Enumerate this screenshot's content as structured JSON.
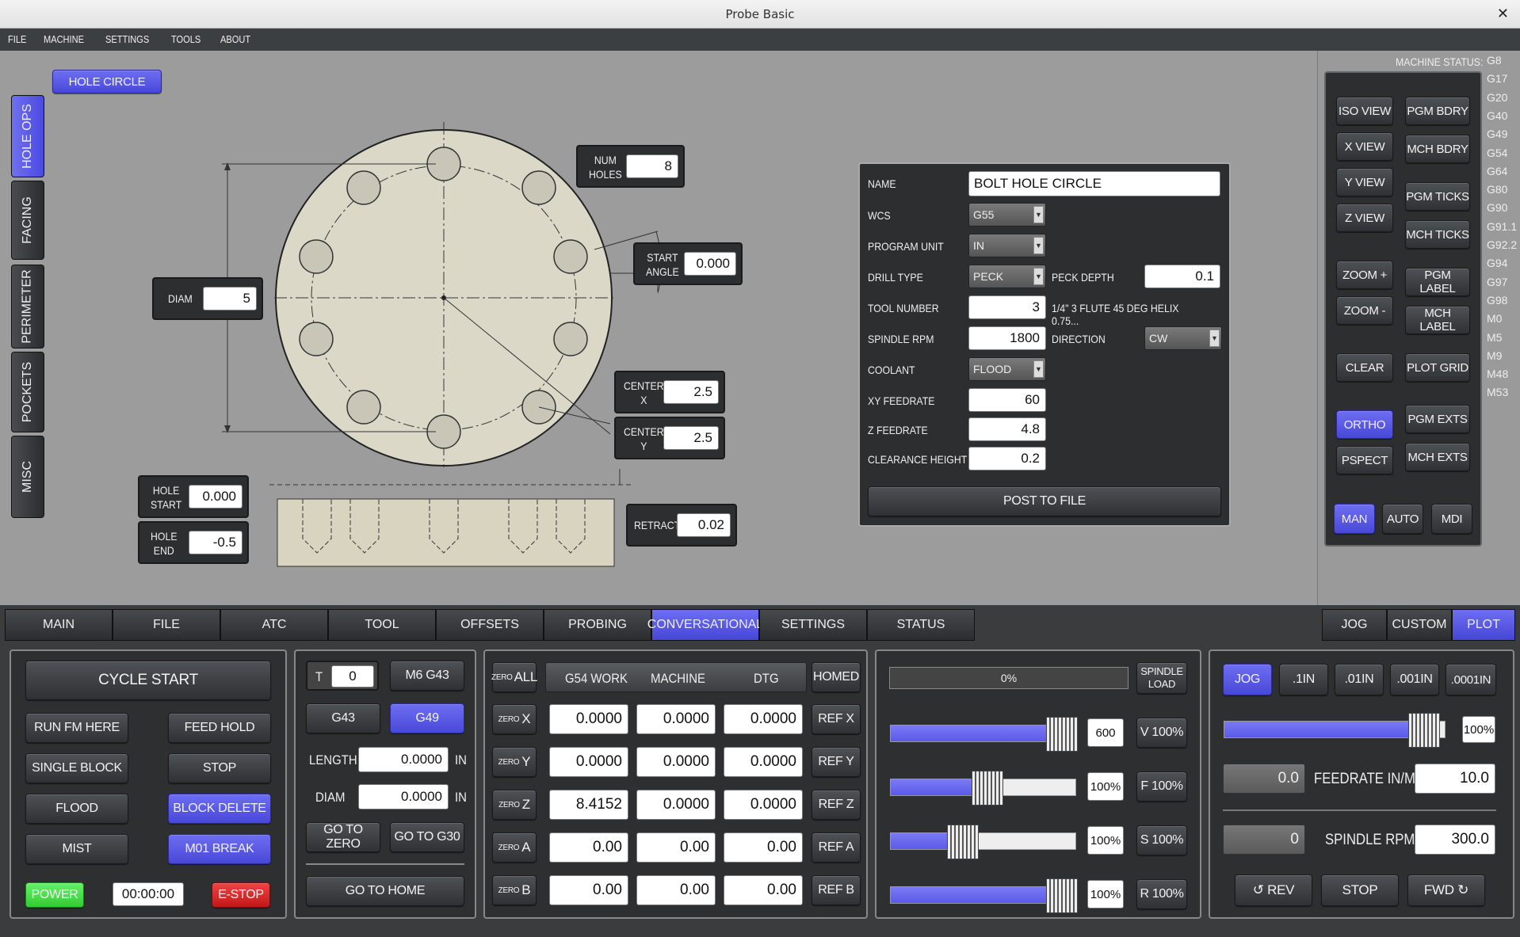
{
  "window": {
    "title": "Probe Basic",
    "close": "✕"
  },
  "menu": [
    "FILE",
    "MACHINE",
    "SETTINGS",
    "TOOLS",
    "ABOUT"
  ],
  "hole_circle_label": "HOLE CIRCLE",
  "side_tabs": [
    "HOLE OPS",
    "FACING",
    "PERIMETER",
    "POCKETS",
    "MISC"
  ],
  "diagram": {
    "num_holes_label": "NUM\nHOLES",
    "num_holes": "8",
    "start_angle_label": "START\nANGLE",
    "start_angle": "0.000",
    "diam_label": "DIAM",
    "diam": "5",
    "center_x_label": "CENTER\nX",
    "center_x": "2.5",
    "center_y_label": "CENTER\nY",
    "center_y": "2.5",
    "hole_start_label": "HOLE\nSTART",
    "hole_start": "0.000",
    "hole_end_label": "HOLE\nEND",
    "hole_end": "-0.5",
    "retract_label": "RETRACT",
    "retract": "0.02"
  },
  "form": {
    "name_label": "NAME",
    "name": "BOLT HOLE CIRCLE",
    "wcs_label": "WCS",
    "wcs": "G55",
    "unit_label": "PROGRAM UNIT",
    "unit": "IN",
    "drill_label": "DRILL TYPE",
    "drill": "PECK",
    "peck_label": "PECK DEPTH",
    "peck": "0.1",
    "tool_label": "TOOL NUMBER",
    "tool": "3",
    "tool_desc": "1/4\" 3 FLUTE 45 DEG HELIX 0.75...",
    "rpm_label": "SPINDLE RPM",
    "rpm": "1800",
    "dir_label": "DIRECTION",
    "dir": "CW",
    "coolant_label": "COOLANT",
    "coolant": "FLOOD",
    "xy_label": "XY FEEDRATE",
    "xy": "60",
    "z_label": "Z FEEDRATE",
    "z": "4.8",
    "clear_label": "CLEARANCE HEIGHT",
    "clear": "0.2",
    "post": "POST TO FILE"
  },
  "machine_status": {
    "title": "MACHINE STATUS:",
    "codes": [
      "G8",
      "G17",
      "G20",
      "G40",
      "G49",
      "G54",
      "G64",
      "G80",
      "G90",
      "G91.1",
      "G92.2",
      "G94",
      "G97",
      "G98",
      "M0",
      "M5",
      "M9",
      "M48",
      "M53"
    ]
  },
  "view_buttons": {
    "iso": "ISO VIEW",
    "x": "X VIEW",
    "y": "Y VIEW",
    "z": "Z VIEW",
    "zin": "ZOOM +",
    "zout": "ZOOM -",
    "clear": "CLEAR",
    "ortho": "ORTHO",
    "pspect": "PSPECT",
    "pgm_bdry": "PGM BDRY",
    "mch_bdry": "MCH BDRY",
    "pgm_ticks": "PGM TICKS",
    "mch_ticks": "MCH TICKS",
    "pgm_label": "PGM LABEL",
    "mch_label": "MCH LABEL",
    "plot_grid": "PLOT GRID",
    "pgm_exts": "PGM EXTS",
    "mch_exts": "MCH EXTS",
    "man": "MAN",
    "auto": "AUTO",
    "mdi": "MDI"
  },
  "bottom_tabs": [
    "MAIN",
    "FILE",
    "ATC",
    "TOOL",
    "OFFSETS",
    "PROBING",
    "CONVERSATIONAL",
    "SETTINGS",
    "STATUS"
  ],
  "right_tabs": [
    "JOG",
    "CUSTOM",
    "PLOT"
  ],
  "controls": {
    "cycle_start": "CYCLE START",
    "run_fm_here": "RUN FM HERE",
    "feed_hold": "FEED HOLD",
    "single_block": "SINGLE BLOCK",
    "stop": "STOP",
    "flood": "FLOOD",
    "block_delete": "BLOCK DELETE",
    "mist": "MIST",
    "m01": "M01 BREAK",
    "power": "POWER",
    "timer": "00:00:00",
    "estop": "E-STOP"
  },
  "tool_panel": {
    "t_label": "T",
    "t": "0",
    "m6g43": "M6 G43",
    "g43": "G43",
    "g49": "G49",
    "length_label": "LENGTH",
    "length": "0.0000",
    "in": "IN",
    "diam_label": "DIAM",
    "diam": "0.0000",
    "goto_zero": "GO TO ZERO",
    "goto_g30": "GO TO G30",
    "goto_home": "GO TO HOME"
  },
  "dro": {
    "zero_all_small": "ZERO",
    "zero_all": "ALL",
    "headers": [
      "G54 WORK",
      "MACHINE",
      "DTG"
    ],
    "homed": "HOMED",
    "rows": [
      {
        "axis": "X",
        "work": "0.0000",
        "mach": "0.0000",
        "dtg": "0.0000",
        "ref": "REF X"
      },
      {
        "axis": "Y",
        "work": "0.0000",
        "mach": "0.0000",
        "dtg": "0.0000",
        "ref": "REF Y"
      },
      {
        "axis": "Z",
        "work": "8.4152",
        "mach": "0.0000",
        "dtg": "0.0000",
        "ref": "REF Z"
      },
      {
        "axis": "A",
        "work": "0.00",
        "mach": "0.00",
        "dtg": "0.00",
        "ref": "REF A"
      },
      {
        "axis": "B",
        "work": "0.00",
        "mach": "0.00",
        "dtg": "0.00",
        "ref": "REF B"
      }
    ]
  },
  "overrides": {
    "load": "0%",
    "spindle_load": "SPINDLE\nLOAD",
    "rapid_val": "600",
    "v": "V 100%",
    "feed_val": "100%",
    "f": "F 100%",
    "spin_val": "100%",
    "s": "S 100%",
    "r_val": "100%",
    "r": "R 100%",
    "levels": {
      "rapid": 0.85,
      "feed": 0.45,
      "spindle": 0.32,
      "r": 0.85
    }
  },
  "jog": {
    "jog": "JOG",
    "inc1": ".1IN",
    "inc2": ".01IN",
    "inc3": ".001IN",
    "inc4": ".0001IN",
    "jog_pct": "100%",
    "jog_level": 0.9,
    "feed_actual": "0.0",
    "feed_label": "FEEDRATE IN/M",
    "feed_set": "10.0",
    "rpm_actual": "0",
    "rpm_label": "SPINDLE RPM",
    "rpm_set": "300.0",
    "rev": "↺ REV",
    "stop": "STOP",
    "fwd": "FWD ↻"
  }
}
